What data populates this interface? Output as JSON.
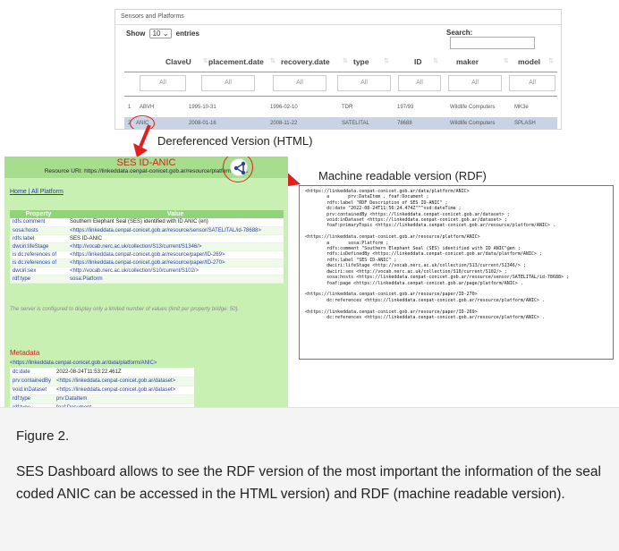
{
  "table_widget": {
    "title": "Sensors and Platforms",
    "show_label": "Show",
    "show_value": "10",
    "entries_label": "entries",
    "search_label": "Search:",
    "columns": [
      "ClaveU",
      "placement.date",
      "recovery.date",
      "type",
      "ID",
      "maker",
      "model"
    ],
    "filter_placeholder": "All",
    "rows": [
      [
        "1",
        "ABVH",
        "1995-10-31",
        "1996-02-10",
        "TDR",
        "197/93",
        "Wildlife Computers",
        "MK3e"
      ],
      [
        "2",
        "ANIC",
        "2008-01-16",
        "2008-11-22",
        "SATELITAL",
        "78688",
        "Wildlife Computers",
        "SPLASH"
      ]
    ]
  },
  "labels": {
    "dereferenced": "Dereferenced Version (HTML)",
    "machine_readable": "Machine readable version (RDF)"
  },
  "html_view": {
    "title": "SES ID-ANIC",
    "resource_uri": "Resource URI: https://linkeddata.cenpat-conicet.gob.ar/resource/platform/ANIC",
    "nav_home": "Home",
    "nav_sep": " | ",
    "nav_all": "All Platform",
    "col_property": "Property",
    "col_value": "Value",
    "properties": [
      {
        "p": "rdfs:comment",
        "v": "Southern Elephant Seal (SES) identified with ID ANIC (en)",
        "link": false
      },
      {
        "p": "sosa:hosts",
        "v": "<https://linkeddata.cenpat-conicet.gob.ar/resource/sensor/SATELITAL/id-78688>",
        "link": true
      },
      {
        "p": "rdfs:label",
        "v": "SES ID-ANIC",
        "link": false
      },
      {
        "p": "dwciri:lifeStage",
        "v": "<http://vocab.nerc.ac.uk/collection/S13/current/S1346/>",
        "link": true
      },
      {
        "p": "is dc:references of",
        "v": "<https://linkeddata.cenpat-conicet.gob.ar/resource/paper/ID-269>",
        "link": true
      },
      {
        "p": "is dc:references of",
        "v": "<https://linkeddata.cenpat-conicet.gob.ar/resource/paper/ID-270>",
        "link": true
      },
      {
        "p": "dwciri:sex",
        "v": "<http://vocab.nerc.ac.uk/collection/S10/current/S102/>",
        "link": true
      },
      {
        "p": "rdf:type",
        "v": "sosa:Platform",
        "link": true
      }
    ],
    "note": "The server is configured to display only a limited number of values (limit per property bridge: 50).",
    "metadata_title": "Metadata",
    "metadata_uri": "<https://linkeddata.cenpat-conicet.gob.ar/data/platform/ANIC>",
    "metadata": [
      {
        "p": "dc:date",
        "v": "2022-08-24T11:53:22.461Z",
        "link": false
      },
      {
        "p": "prv:containedBy",
        "v": "<https://linkeddata.cenpat-conicet.gob.ar/dataset>",
        "link": true
      },
      {
        "p": "void:inDataset",
        "v": "<https://linkeddata.cenpat-conicet.gob.ar/dataset>",
        "link": true
      },
      {
        "p": "rdf:type",
        "v": "prv:DataItem",
        "link": true
      },
      {
        "p": "rdf:type",
        "v": "foaf:Document",
        "link": true
      }
    ]
  },
  "rdf_text": "<https://linkeddata.cenpat-conicet.gob.ar/data/platform/ANIC>\n        a       prv:DataItem , foaf:Document ;\n        rdfs:label \"RDF Description of SES ID-ANIC\" ;\n        dc:date \"2022-08-24T11:56:24.474Z\"^^xsd:dateTime ;\n        prv:containedBy <https://linkeddata.cenpat-conicet.gob.ar/dataset> ;\n        void:inDataset <https://linkeddata.cenpat-conicet.gob.ar/dataset> ;\n        foaf:primaryTopic <https://linkeddata.cenpat-conicet.gob.ar/resource/platform/ANIC> .\n\n<https://linkeddata.cenpat-conicet.gob.ar/resource/platform/ANIC>\n        a       sosa:Platform ;\n        rdfs:comment \"Southern Elephant Seal (SES) identified with ID ANIC\"@en ;\n        rdfs:isDefinedBy <https://linkeddata.cenpat-conicet.gob.ar/data/platform/ANIC> ;\n        rdfs:label \"SES ID-ANIC\" ;\n        dwciri:lifeStage <http://vocab.nerc.ac.uk/collection/S13/current/S1346/> ;\n        dwciri:sex <http://vocab.nerc.ac.uk/collection/S10/current/S102/> ;\n        sosa:hosts <https://linkeddata.cenpat-conicet.gob.ar/resource/sensor/SATELITAL/id-78688> ;\n        foaf:page <https://linkeddata.cenpat-conicet.gob.ar/page/platform/ANIC> .\n\n<https://linkeddata.cenpat-conicet.gob.ar/resource/paper/ID-270>\n        dc:references <https://linkeddata.cenpat-conicet.gob.ar/resource/platform/ANIC> .\n\n<https://linkeddata.cenpat-conicet.gob.ar/resource/paper/ID-269>\n        dc:references <https://linkeddata.cenpat-conicet.gob.ar/resource/platform/ANIC> .",
  "caption": {
    "figure_label": "Figure 2.",
    "text": "SES Dashboard allows to see the RDF version of the most important the information of the seal coded ANIC can be accessed in the HTML version) and RDF (machine readable version)."
  },
  "colors": {
    "highlight_red": "#e0201c",
    "panel_green": "#c8f0b3",
    "header_green": "#8fd476",
    "link_blue": "#2a3e9c",
    "selected_row": "#c9d3e6"
  }
}
